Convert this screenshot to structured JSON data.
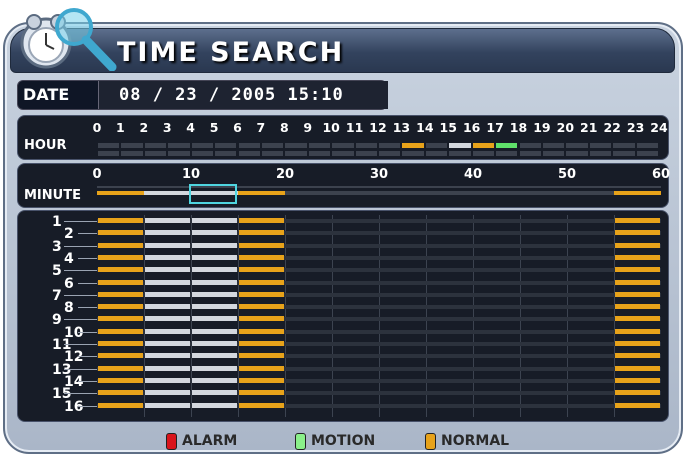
{
  "window": {
    "title": "TIME SEARCH"
  },
  "date": {
    "label": "DATE",
    "value": "08 / 23 / 2005  15:10"
  },
  "hour_bar": {
    "label": "HOUR",
    "ticks": [
      "0",
      "1",
      "2",
      "3",
      "4",
      "5",
      "6",
      "7",
      "8",
      "9",
      "10",
      "11",
      "12",
      "13",
      "14",
      "15",
      "16",
      "17",
      "18",
      "19",
      "20",
      "21",
      "22",
      "23",
      "24"
    ],
    "segments": [
      "none",
      "none",
      "none",
      "none",
      "none",
      "none",
      "none",
      "none",
      "none",
      "none",
      "none",
      "none",
      "none",
      "normal",
      "none",
      "mixed",
      "normal",
      "motion",
      "none",
      "none",
      "none",
      "none",
      "none",
      "none"
    ]
  },
  "minute_bar": {
    "label": "MINUTE",
    "ticks": [
      "0",
      "10",
      "20",
      "30",
      "40",
      "50",
      "60"
    ],
    "segments": [
      "normal",
      "mixed",
      "mixed",
      "normal",
      "none",
      "none",
      "none",
      "none",
      "none",
      "none",
      "none",
      "normal"
    ],
    "selected_index": 2
  },
  "channels": {
    "labels": [
      "1",
      "2",
      "3",
      "4",
      "5",
      "6",
      "7",
      "8",
      "9",
      "10",
      "11",
      "12",
      "13",
      "14",
      "15",
      "16"
    ],
    "rows": [
      [
        "normal",
        "mixed",
        "mixed",
        "normal",
        "none",
        "none",
        "none",
        "none",
        "none",
        "none",
        "none",
        "normal"
      ]
    ]
  },
  "legend": {
    "items": [
      {
        "label": "ALARM",
        "color": "#d9141b"
      },
      {
        "label": "MOTION",
        "color": "#8af08a"
      },
      {
        "label": "NORMAL",
        "color": "#e7a21a"
      }
    ]
  },
  "colors": {
    "normal": "#e7a21a",
    "mixed": "#d3d7de",
    "motion": "#5fe06a",
    "cursor": "#4fd5e0"
  }
}
